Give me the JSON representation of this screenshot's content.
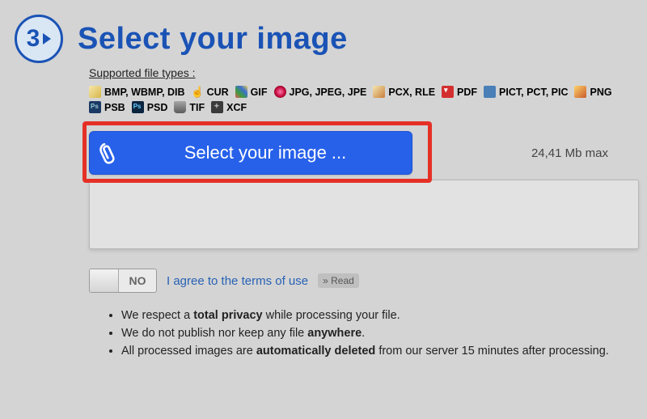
{
  "step": {
    "number": "3",
    "title": "Select your image"
  },
  "supported": {
    "label": "Supported file types :",
    "items": [
      {
        "icon": "paint",
        "text": "BMP, WBMP, DIB"
      },
      {
        "icon": "cursor",
        "text": "CUR"
      },
      {
        "icon": "gif",
        "text": "GIF"
      },
      {
        "icon": "jpg",
        "text": "JPG, JPEG, JPE"
      },
      {
        "icon": "pcx",
        "text": "PCX, RLE"
      },
      {
        "icon": "pdf",
        "text": "PDF"
      },
      {
        "icon": "pict",
        "text": "PICT, PCT, PIC"
      },
      {
        "icon": "png",
        "text": "PNG"
      },
      {
        "icon": "psb",
        "text": "PSB"
      },
      {
        "icon": "psd",
        "text": "PSD"
      },
      {
        "icon": "tif",
        "text": "TIF"
      },
      {
        "icon": "xcf",
        "text": "XCF"
      }
    ]
  },
  "upload": {
    "button_label": "Select your image ...",
    "max_label": "24,41 Mb max"
  },
  "terms": {
    "toggle_state": "NO",
    "agree_text": "I agree to the terms of use",
    "read_label": "» Read"
  },
  "privacy": {
    "line1_a": "We respect a ",
    "line1_b": "total privacy",
    "line1_c": " while processing your file.",
    "line2_a": "We do not publish nor keep any file ",
    "line2_b": "anywhere",
    "line2_c": ".",
    "line3_a": "All processed images are ",
    "line3_b": "automatically deleted",
    "line3_c": " from our server 15 minutes after processing."
  }
}
